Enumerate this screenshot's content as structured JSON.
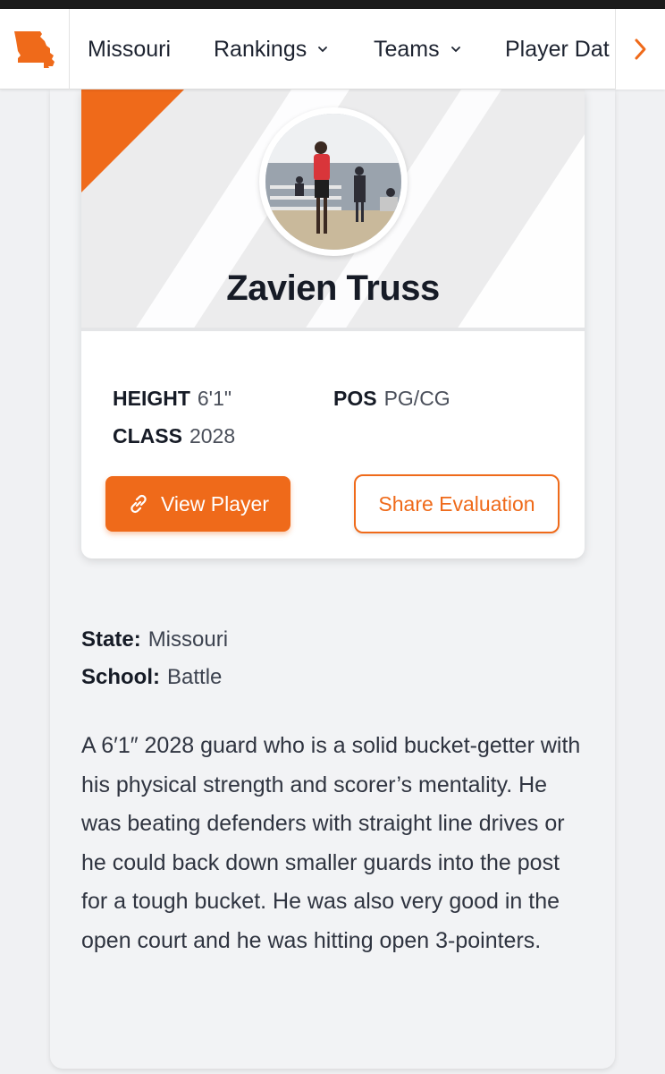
{
  "nav": {
    "items": [
      {
        "label": "Missouri",
        "has_dropdown": false
      },
      {
        "label": "Rankings",
        "has_dropdown": true
      },
      {
        "label": "Teams",
        "has_dropdown": true
      },
      {
        "label": "Player Dat",
        "has_dropdown": false
      }
    ],
    "logo_icon": "missouri-state-icon",
    "next_icon": "chevron-right-icon"
  },
  "player": {
    "name": "Zavien Truss",
    "height_label": "HEIGHT",
    "height_value": "6'1\"",
    "pos_label": "POS",
    "pos_value": "PG/CG",
    "class_label": "CLASS",
    "class_value": "2028"
  },
  "buttons": {
    "view_player": "View Player",
    "view_player_icon": "link-icon",
    "share_evaluation": "Share Evaluation"
  },
  "details": {
    "state_label": "State:",
    "state_value": "Missouri",
    "school_label": "School:",
    "school_value": "Battle"
  },
  "evaluation": "A 6′1″ 2028 guard who is a solid bucket-getter with his physical strength and scorer’s mentality. He was beating defenders with straight line drives or he could back down smaller guards into the post for a tough bucket. He was also very good in the open court and he was hitting open 3-pointers.",
  "colors": {
    "accent": "#ef6a1a",
    "text_dark": "#161b26",
    "background": "#f0f1f3"
  }
}
